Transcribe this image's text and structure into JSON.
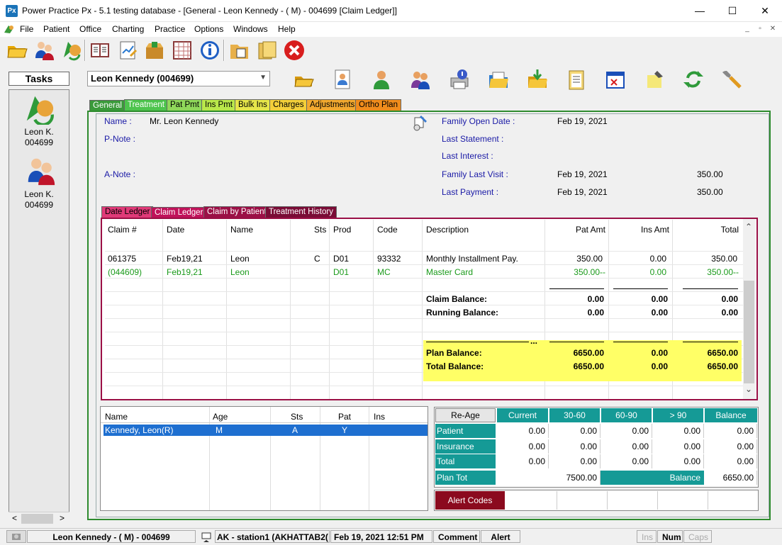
{
  "window": {
    "logo": "Px",
    "title": "Power Practice Px - 5.1 testing database - [General - Leon Kennedy - ( M) - 004699 [Claim Ledger]]",
    "min": "—",
    "max": "☐",
    "close": "✕"
  },
  "menu": [
    "File",
    "Patient",
    "Office",
    "Charting",
    "Practice",
    "Options",
    "Windows",
    "Help"
  ],
  "mdi": [
    "_",
    "▫",
    "✕"
  ],
  "tasks": {
    "title": "Tasks",
    "items": [
      {
        "line1": "Leon K.",
        "line2": "004699",
        "icon": "patient-refresh-icon"
      },
      {
        "line1": "Leon K.",
        "line2": "004699",
        "icon": "family-icon"
      }
    ]
  },
  "patient_combo": "Leon Kennedy (004699)",
  "tabs": [
    {
      "label": "General",
      "bg": "#3a9a3a",
      "fg": "#fff"
    },
    {
      "label": "Treatment",
      "bg": "#4dc44d",
      "fg": "#fff"
    },
    {
      "label": "Pat Pmt",
      "bg": "#8fd85a",
      "fg": "#000"
    },
    {
      "label": "Ins Pmt",
      "bg": "#b9e84a",
      "fg": "#000"
    },
    {
      "label": "Bulk Ins",
      "bg": "#e6e64a",
      "fg": "#000"
    },
    {
      "label": "Charges",
      "bg": "#f3cf3a",
      "fg": "#000"
    },
    {
      "label": "Adjustments",
      "bg": "#f2a92f",
      "fg": "#000"
    },
    {
      "label": "Ortho Plan",
      "bg": "#f08c1c",
      "fg": "#000"
    }
  ],
  "general": {
    "name_label": "Name :",
    "name_value": "Mr. Leon Kennedy",
    "pnote_label": "P-Note :",
    "anote_label": "A-Note :",
    "family_open_label": "Family Open Date :",
    "family_open_value": "Feb 19, 2021",
    "last_statement_label": "Last Statement :",
    "last_interest_label": "Last Interest :",
    "family_last_visit_label": "Family Last Visit :",
    "family_last_visit_date": "Feb 19, 2021",
    "family_last_visit_amt": "350.00",
    "last_payment_label": "Last Payment :",
    "last_payment_date": "Feb 19, 2021",
    "last_payment_amt": "350.00"
  },
  "subtabs": [
    {
      "label": "Date Ledger",
      "bg": "#e03a78",
      "fg": "#000"
    },
    {
      "label": "Claim Ledger",
      "bg": "#c0125a",
      "fg": "#fff"
    },
    {
      "label": "Claim by Patient",
      "bg": "#9b1046",
      "fg": "#fff"
    },
    {
      "label": "Treatment History",
      "bg": "#7a0c36",
      "fg": "#fff"
    }
  ],
  "ledger": {
    "headers": [
      "Claim #",
      "Date",
      "Name",
      "Sts",
      "Prod",
      "Code",
      "Description",
      "Pat Amt",
      "Ins Amt",
      "Total"
    ],
    "row1": [
      "061375",
      "Feb19,21",
      "Leon",
      "C",
      "D01",
      "93332",
      "Monthly Installment Pay.",
      "350.00",
      "0.00",
      "350.00"
    ],
    "row2": [
      "(044609)",
      "Feb19,21",
      "Leon",
      "",
      "D01",
      "MC",
      "Master Card",
      "350.00--",
      "0.00",
      "350.00--"
    ],
    "claim_balance": [
      "Claim Balance:",
      "0.00",
      "0.00",
      "0.00"
    ],
    "running_balance": [
      "Running Balance:",
      "0.00",
      "0.00",
      "0.00"
    ],
    "plan_balance": [
      "Plan Balance:",
      "6650.00",
      "0.00",
      "6650.00"
    ],
    "total_balance": [
      "Total Balance:",
      "6650.00",
      "0.00",
      "6650.00"
    ],
    "ellipsis": "...",
    "scroll_up": "⌃",
    "scroll_down": "⌄"
  },
  "patients": {
    "headers": [
      "Name",
      "Age",
      "Sts",
      "Pat",
      "Ins"
    ],
    "rows": [
      [
        "Kennedy, Leon(R)",
        "M",
        "A",
        "Y",
        ""
      ]
    ]
  },
  "aging": {
    "reage": "Re-Age",
    "headers": [
      "Current",
      "30-60",
      "60-90",
      "> 90",
      "Balance"
    ],
    "rows": [
      {
        "label": "Patient",
        "values": [
          "0.00",
          "0.00",
          "0.00",
          "0.00",
          "0.00"
        ]
      },
      {
        "label": "Insurance",
        "values": [
          "0.00",
          "0.00",
          "0.00",
          "0.00",
          "0.00"
        ]
      },
      {
        "label": "Total",
        "values": [
          "0.00",
          "0.00",
          "0.00",
          "0.00",
          "0.00"
        ]
      }
    ],
    "plan_tot_label": "Plan Tot",
    "plan_tot_value": "7500.00",
    "balance_label": "Balance",
    "balance_value": "6650.00",
    "alert_codes": "Alert Codes"
  },
  "status": {
    "patient": "Leon Kennedy - ( M) - 004699",
    "station": "AK - station1 (AKHATTAB2(",
    "datetime": "Feb 19, 2021 12:51 PM",
    "comment": "Comment",
    "alert": "Alert",
    "ins": "Ins",
    "num": "Num",
    "caps": "Caps"
  },
  "colors": {
    "teal": "#159a96",
    "maroon": "#9b1046",
    "green": "#2e8b2e",
    "highlight": "#ffff66",
    "selection": "#1e6fd0"
  }
}
